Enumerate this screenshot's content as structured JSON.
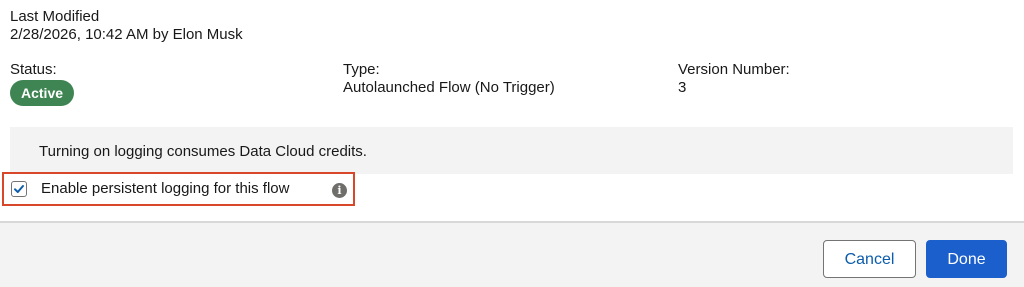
{
  "last_modified": {
    "label": "Last Modified",
    "value": "2/28/2026, 10:42 AM by Elon Musk"
  },
  "details": {
    "status_label": "Status:",
    "status_value": "Active",
    "type_label": "Type:",
    "type_value": "Autolaunched Flow (No Trigger)",
    "version_label": "Version Number:",
    "version_value": "3"
  },
  "notice": {
    "text": "Turning on logging consumes Data Cloud credits."
  },
  "logging": {
    "label": "Enable persistent logging for this flow",
    "checked": true,
    "info_icon": "info-icon"
  },
  "footer": {
    "cancel_label": "Cancel",
    "done_label": "Done"
  },
  "colors": {
    "status_badge": "#3f8553",
    "primary_button": "#1b5fcc",
    "highlight_border": "#d9472b"
  }
}
